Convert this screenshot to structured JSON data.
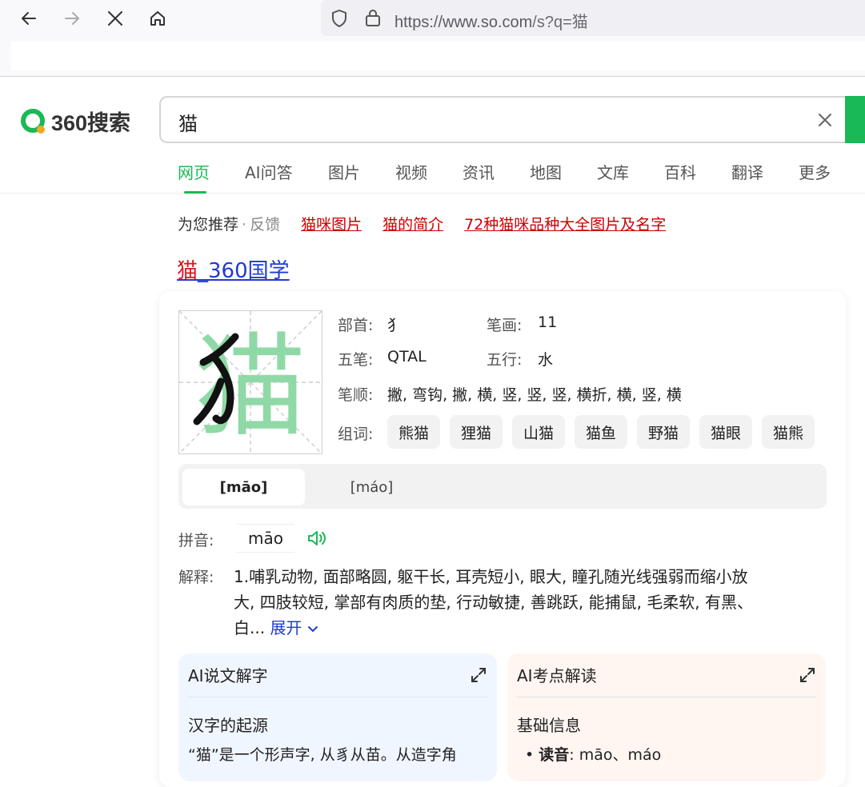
{
  "browser": {
    "url_prefix": "https://www.so.com",
    "url_rest": "/s?q=猫"
  },
  "header": {
    "logo_text": "360搜索",
    "search_value": "猫"
  },
  "tabs": [
    "网页",
    "AI问答",
    "图片",
    "视频",
    "资讯",
    "地图",
    "文库",
    "百科",
    "翻译",
    "更多"
  ],
  "recommend": {
    "label": "为您推荐",
    "sep": "·",
    "feedback": "反馈",
    "links": [
      "猫咪图片",
      "猫的简介",
      "72种猫咪品种大全图片及名字"
    ]
  },
  "result": {
    "title_highlight": "猫",
    "title_rest": "_360国学"
  },
  "character": {
    "glyph": "猫",
    "radical_label": "部首:",
    "radical": "犭",
    "strokes_label": "笔画:",
    "strokes": "11",
    "wubi_label": "五笔:",
    "wubi": "QTAL",
    "wuxing_label": "五行:",
    "wuxing": "水",
    "order_label": "笔顺:",
    "order": "撇, 弯钩, 撇, 横, 竖, 竖, 竖, 横折, 横, 竖, 横",
    "words_label": "组词:",
    "words": [
      "熊猫",
      "狸猫",
      "山猫",
      "猫鱼",
      "野猫",
      "猫眼",
      "猫熊"
    ]
  },
  "pronunciations": [
    "[māo]",
    "[máo]"
  ],
  "pinyin": {
    "label": "拼音:",
    "value": "māo"
  },
  "definition": {
    "label": "解释:",
    "line1": "1.哺乳动物, 面部略圆, 躯干长, 耳壳短小, 眼大, 瞳孔随光线强弱而缩小放",
    "line2": "大, 四肢较短, 掌部有肉质的垫, 行动敏捷, 善跳跃, 能捕鼠, 毛柔软, 有黑、",
    "line3": "白...",
    "more": "展开"
  },
  "ai_left": {
    "title": "AI说文解字",
    "subtitle": "汉字的起源",
    "body": "“猫”是一个形声字, 从豸从苗。从造字角"
  },
  "ai_right": {
    "title": "AI考点解读",
    "subtitle": "基础信息",
    "bullet_label": "读音",
    "bullet_value": ": māo、máo"
  },
  "colors": {
    "brand_green": "#19b955",
    "link_red": "#cc0000",
    "link_blue": "#1f3bd1"
  }
}
